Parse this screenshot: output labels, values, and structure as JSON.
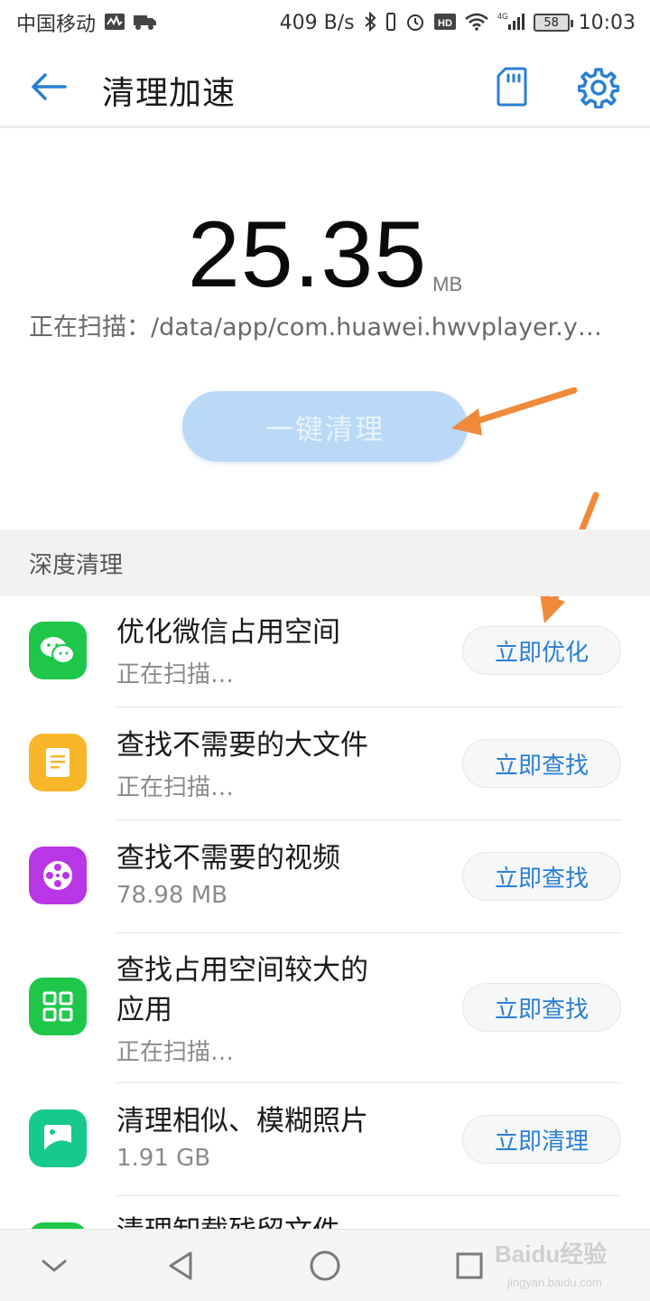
{
  "status_bar": {
    "carrier": "中国移动",
    "network_speed": "409 B/s",
    "signal_label": "4G",
    "battery": "58",
    "time": "10:03",
    "icons": [
      "activity-icon",
      "truck-icon",
      "bluetooth-icon",
      "vibrate-icon",
      "alarm-icon",
      "hd-icon",
      "wifi-icon",
      "cell-signal-icon"
    ]
  },
  "app_bar": {
    "title": "清理加速",
    "icons": [
      "back-arrow-icon",
      "sd-card-icon",
      "gear-icon"
    ]
  },
  "scan": {
    "size_value": "25.35",
    "size_unit": "MB",
    "path_text": "正在扫描：/data/app/com.huawei.hwvplayer.y…",
    "clean_button_label": "一键清理"
  },
  "section": {
    "title": "深度清理"
  },
  "items": [
    {
      "title": "优化微信占用空间",
      "subtitle": "正在扫描…",
      "button": "立即优化",
      "icon": "wechat-icon",
      "color": "#1ec74a"
    },
    {
      "title": "查找不需要的大文件",
      "subtitle": "正在扫描…",
      "button": "立即查找",
      "icon": "document-icon",
      "color": "#f8b62a"
    },
    {
      "title": "查找不需要的视频",
      "subtitle": "78.98 MB",
      "button": "立即查找",
      "icon": "film-reel-icon",
      "color": "#b936e6"
    },
    {
      "title_line1": "查找占用空间较大的",
      "title_line2": "应用",
      "subtitle": "正在扫描…",
      "button": "立即查找",
      "icon": "apps-grid-icon",
      "color": "#1ec74a"
    },
    {
      "title": "清理相似、模糊照片",
      "subtitle": "1.91 GB",
      "button": "立即清理",
      "icon": "photo-icon",
      "color": "#17c98a"
    },
    {
      "title": "清理卸载残留文件",
      "icon": "app-icon-partial",
      "color": "#1ec74a"
    }
  ],
  "nav_bar": {
    "icons": [
      "collapse-chevron-icon",
      "back-triangle-icon",
      "home-circle-icon",
      "recents-square-icon"
    ]
  },
  "watermark": {
    "brand": "Baidu经验",
    "url": "jingyan.baidu.com"
  },
  "colors": {
    "accent": "#2a7fd4",
    "clean_button_bg": "#b9d9f6",
    "annotation_arrow": "#f0893a"
  }
}
